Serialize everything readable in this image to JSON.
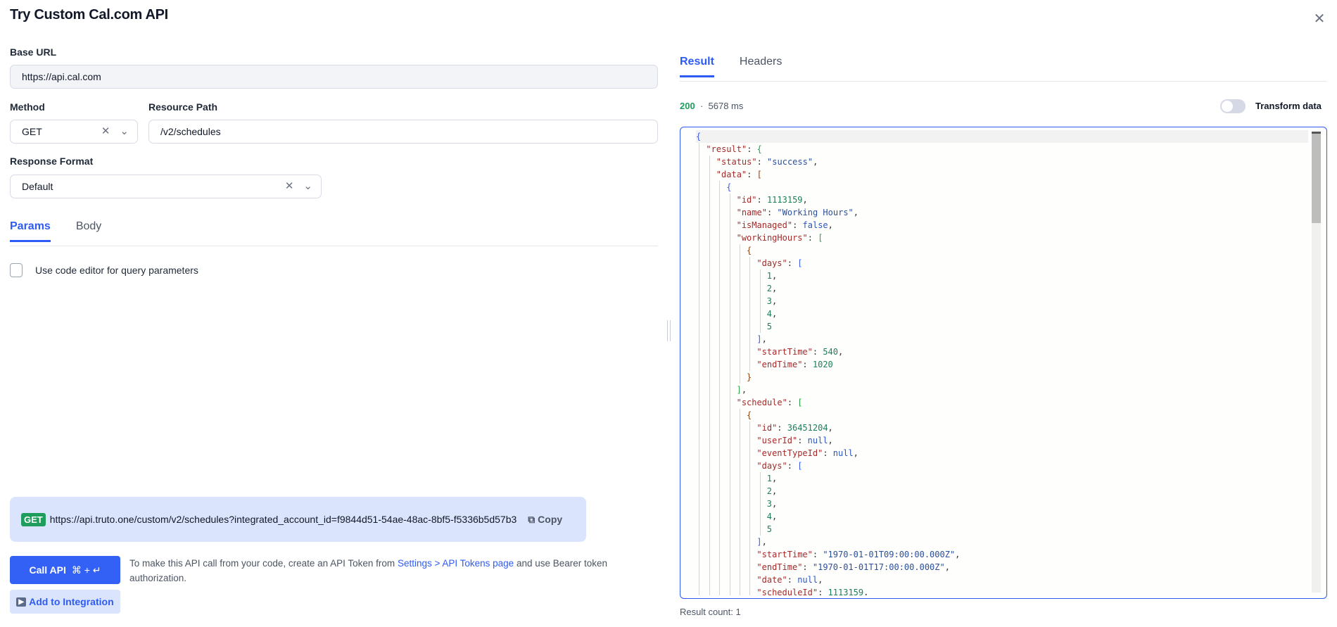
{
  "title": "Try Custom Cal.com API",
  "left": {
    "base_url_label": "Base URL",
    "base_url": "https://api.cal.com",
    "method_label": "Method",
    "method": "GET",
    "resource_path_label": "Resource Path",
    "resource_path": "/v2/schedules",
    "response_format_label": "Response Format",
    "response_format": "Default",
    "tabs": [
      "Params",
      "Body"
    ],
    "checkbox_label": "Use code editor for query parameters",
    "url_method": "GET",
    "url": "https://api.truto.one/custom/v2/schedules?integrated_account_id=f9844d51-54ae-48ac-8bf5-f5336b5d57b3",
    "copy_label": "Copy",
    "call_api": "Call API",
    "shortcut": "⌘ + ↵",
    "help_pre": "To make this API call from your code, create an API Token from ",
    "help_link": "Settings > API Tokens page",
    "help_post": " and use Bearer token authorization.",
    "add_to_integration": "Add to Integration"
  },
  "right": {
    "tabs": [
      "Result",
      "Headers"
    ],
    "status_code": "200",
    "separator": "·",
    "duration": "5678 ms",
    "transform_label": "Transform data",
    "transform_on": false,
    "result_count": "Result count: 1",
    "code_lines": [
      {
        "i": 0,
        "v": "{",
        "t": "bb"
      },
      {
        "i": 1,
        "k": "\"result\"",
        "v": "{",
        "t": "bg"
      },
      {
        "i": 2,
        "k": "\"status\"",
        "v": "\"success\"",
        "t": "s",
        "p": ","
      },
      {
        "i": 2,
        "k": "\"data\"",
        "v": "[",
        "t": "br"
      },
      {
        "i": 3,
        "v": "{",
        "t": "bb"
      },
      {
        "i": 4,
        "k": "\"id\"",
        "v": "1113159",
        "t": "n",
        "p": ","
      },
      {
        "i": 4,
        "k": "\"name\"",
        "v": "\"Working Hours\"",
        "t": "s",
        "p": ","
      },
      {
        "i": 4,
        "k": "\"isManaged\"",
        "v": "false",
        "t": "l",
        "p": ","
      },
      {
        "i": 4,
        "k": "\"workingHours\"",
        "v": "[",
        "t": "bg"
      },
      {
        "i": 5,
        "v": "{",
        "t": "br"
      },
      {
        "i": 6,
        "k": "\"days\"",
        "v": "[",
        "t": "bb"
      },
      {
        "i": 7,
        "v": "1",
        "t": "n",
        "p": ","
      },
      {
        "i": 7,
        "v": "2",
        "t": "n",
        "p": ","
      },
      {
        "i": 7,
        "v": "3",
        "t": "n",
        "p": ","
      },
      {
        "i": 7,
        "v": "4",
        "t": "n",
        "p": ","
      },
      {
        "i": 7,
        "v": "5",
        "t": "n"
      },
      {
        "i": 6,
        "v": "]",
        "t": "bb",
        "p": ","
      },
      {
        "i": 6,
        "k": "\"startTime\"",
        "v": "540",
        "t": "n",
        "p": ","
      },
      {
        "i": 6,
        "k": "\"endTime\"",
        "v": "1020",
        "t": "n"
      },
      {
        "i": 5,
        "v": "}",
        "t": "br"
      },
      {
        "i": 4,
        "v": "]",
        "t": "bg",
        "p": ","
      },
      {
        "i": 4,
        "k": "\"schedule\"",
        "v": "[",
        "t": "bg"
      },
      {
        "i": 5,
        "v": "{",
        "t": "br"
      },
      {
        "i": 6,
        "k": "\"id\"",
        "v": "36451204",
        "t": "n",
        "p": ","
      },
      {
        "i": 6,
        "k": "\"userId\"",
        "v": "null",
        "t": "l",
        "p": ","
      },
      {
        "i": 6,
        "k": "\"eventTypeId\"",
        "v": "null",
        "t": "l",
        "p": ","
      },
      {
        "i": 6,
        "k": "\"days\"",
        "v": "[",
        "t": "bb"
      },
      {
        "i": 7,
        "v": "1",
        "t": "n",
        "p": ","
      },
      {
        "i": 7,
        "v": "2",
        "t": "n",
        "p": ","
      },
      {
        "i": 7,
        "v": "3",
        "t": "n",
        "p": ","
      },
      {
        "i": 7,
        "v": "4",
        "t": "n",
        "p": ","
      },
      {
        "i": 7,
        "v": "5",
        "t": "n"
      },
      {
        "i": 6,
        "v": "]",
        "t": "bb",
        "p": ","
      },
      {
        "i": 6,
        "k": "\"startTime\"",
        "v": "\"1970-01-01T09:00:00.000Z\"",
        "t": "s",
        "p": ","
      },
      {
        "i": 6,
        "k": "\"endTime\"",
        "v": "\"1970-01-01T17:00:00.000Z\"",
        "t": "s",
        "p": ","
      },
      {
        "i": 6,
        "k": "\"date\"",
        "v": "null",
        "t": "l",
        "p": ","
      },
      {
        "i": 6,
        "k": "\"scheduleId\"",
        "v": "1113159",
        "t": "n",
        "p": ","
      }
    ]
  },
  "icons": {
    "close": "close-icon",
    "clear": "x-icon",
    "chevron": "chevron-down-icon",
    "copy": "copy-icon",
    "play": "play-icon"
  },
  "colors": {
    "accent": "#2f5bf5",
    "success": "#1f9d5c"
  }
}
